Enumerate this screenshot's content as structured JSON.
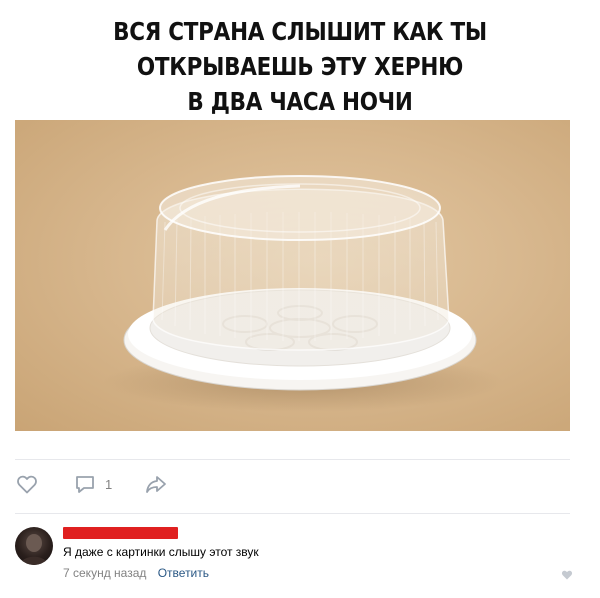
{
  "caption": {
    "lines": [
      "ВСЯ СТРАНА СЛЫШИТ КАК ТЫ",
      "ОТКРЫВАЕШЬ ЭТУ ХЕРНЮ",
      "В ДВА ЧАСА НОЧИ"
    ]
  },
  "photo": {
    "subject": "plastic cake container"
  },
  "actions": {
    "like_icon": "heart-icon",
    "comment_icon": "comment-icon",
    "comment_count": "1",
    "share_icon": "share-arrow-icon"
  },
  "comment": {
    "text": "Я даже с картинки слышу этот звук",
    "time": "7 секунд назад",
    "reply_label": "Ответить",
    "author_redaction_color": "#e02020"
  },
  "colors": {
    "icon": "#99a2ad",
    "link": "#2a5885",
    "muted": "#828282"
  }
}
